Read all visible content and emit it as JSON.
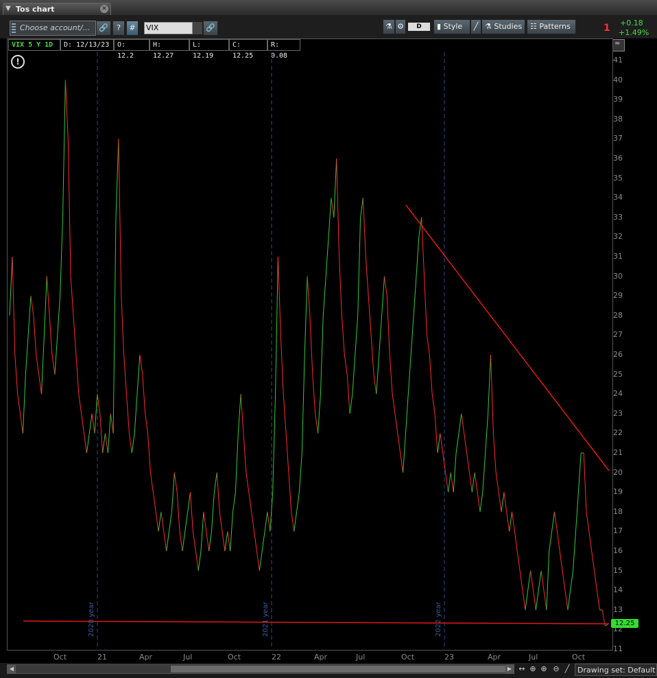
{
  "window": {
    "title": "Tos chart"
  },
  "toolbar": {
    "account_placeholder": "Choose account/...",
    "help_label": "?",
    "hash_label": "#",
    "symbol_value": "VIX",
    "period_label": "D",
    "style_label": "Style",
    "studies_label": "Studies",
    "patterns_label": "Patterns"
  },
  "pl": {
    "count": "1",
    "change": "+0.18",
    "percent": "+1.49%"
  },
  "info": {
    "ticker": "VIX 5 Y 1D",
    "date": "D: 12/13/23",
    "open": "O: 12.2",
    "high": "H: 12.27",
    "low": "L: 12.19",
    "close": "C: 12.25",
    "range": "R: 0.08"
  },
  "price_tag": "12.25",
  "bottom": {
    "drawing_set": "Drawing set: Default"
  },
  "colors": {
    "up": "#33cc33",
    "down": "#ff2a2a",
    "trendline": "#e01818",
    "divider": "#2a4a8a"
  },
  "chart_data": {
    "type": "line",
    "ylim": [
      11,
      41
    ],
    "yticks": [
      11,
      12,
      13,
      14,
      15,
      16,
      17,
      18,
      19,
      20,
      21,
      22,
      23,
      24,
      25,
      26,
      27,
      28,
      29,
      30,
      31,
      32,
      33,
      34,
      35,
      36,
      37,
      38,
      39,
      40,
      41
    ],
    "xticks": [
      "Oct",
      "21",
      "Apr",
      "Jul",
      "Oct",
      "22",
      "Apr",
      "Jul",
      "Oct",
      "23",
      "Apr",
      "Jul",
      "Oct"
    ],
    "year_labels": [
      "2020 year",
      "2021 year",
      "2022 year"
    ],
    "series": [
      {
        "values": [
          28,
          31,
          26,
          24,
          23,
          22,
          25,
          27,
          29,
          28,
          26,
          25,
          24,
          27,
          30,
          28,
          26,
          25,
          27,
          29,
          33,
          40,
          37,
          30,
          28,
          26,
          24,
          23,
          22,
          21,
          22,
          23,
          22,
          24,
          23,
          21,
          22,
          21,
          23,
          22,
          33,
          37,
          29,
          26,
          24,
          22,
          21,
          22,
          24,
          26,
          25,
          23,
          22,
          20,
          19,
          18,
          17,
          18,
          17,
          16,
          17,
          18,
          20,
          19,
          17,
          16,
          17,
          18,
          19,
          17,
          16,
          15,
          16,
          18,
          17,
          16,
          17,
          19,
          20,
          18,
          17,
          16,
          17,
          16,
          18,
          19,
          22,
          24,
          22,
          20,
          19,
          18,
          17,
          16,
          15,
          16,
          17,
          18,
          17,
          19,
          24,
          31,
          27,
          24,
          22,
          20,
          18,
          17,
          18,
          19,
          21,
          26,
          30,
          28,
          25,
          23,
          22,
          24,
          28,
          30,
          32,
          34,
          33,
          36,
          31,
          28,
          26,
          25,
          23,
          24,
          26,
          28,
          33,
          34,
          31,
          29,
          27,
          25,
          24,
          26,
          28,
          30,
          29,
          26,
          24,
          23,
          22,
          21,
          20,
          22,
          24,
          26,
          28,
          30,
          32,
          33,
          30,
          27,
          26,
          24,
          23,
          21,
          22,
          21,
          20,
          19,
          20,
          19,
          21,
          22,
          23,
          22,
          21,
          20,
          19,
          20,
          19,
          18,
          19,
          21,
          23,
          26,
          22,
          20,
          19,
          18,
          19,
          18,
          17,
          18,
          17,
          16,
          15,
          14,
          13,
          14,
          15,
          14,
          13,
          14,
          15,
          14,
          13,
          16,
          17,
          18,
          17,
          16,
          15,
          14,
          13,
          14,
          15,
          17,
          19,
          21,
          21,
          18,
          17,
          16,
          15,
          14,
          13,
          13,
          12.2,
          12.25
        ]
      }
    ]
  }
}
